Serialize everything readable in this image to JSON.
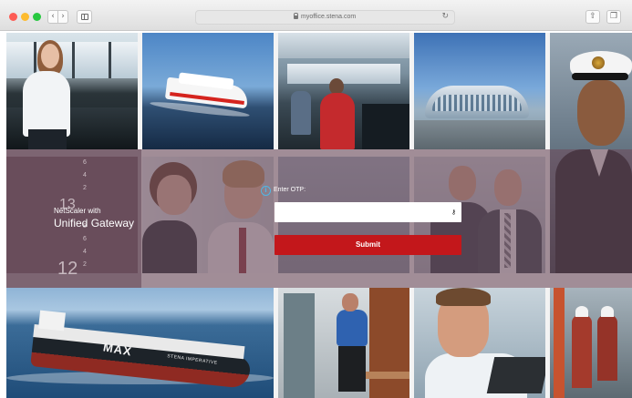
{
  "browser": {
    "url": "myoffice.stena.com",
    "back_icon": "chevron-left-icon",
    "forward_icon": "chevron-right-icon",
    "sidebar_icon": "sidebar-icon",
    "reload_icon": "reload-icon",
    "share_icon": "share-icon",
    "tabs_icon": "tabs-icon",
    "traffic_lights": [
      "#fd5c55",
      "#fdbb2f",
      "#28c840"
    ]
  },
  "background_tiles": [
    "bridge-officer-photo",
    "stena-line-ferry-photo",
    "ship-bridge-crew-photo",
    "cruise-terminal-photo",
    "naval-officer-photo",
    "office-colleagues-photo",
    "business-people-photo",
    "stena-tanker-photo",
    "deck-worker-photo",
    "engineer-laptop-photo",
    "port-workers-photo"
  ],
  "tanker": {
    "hull_label": "MAX",
    "name_label": "STENA IMPERATIVE"
  },
  "decor_digits": {
    "column": [
      "6",
      "4",
      "2",
      "",
      "",
      "8",
      "6",
      "4",
      "2"
    ],
    "large_top": "13",
    "large_bottom": "12"
  },
  "brand": {
    "subtitle": "NetScaler with",
    "title": "Unified Gateway"
  },
  "otp_form": {
    "info_icon": "info-icon",
    "label": "Enter OTP:",
    "input_value": "",
    "key_icon": "key-icon",
    "submit_label": "Submit",
    "accent_color": "#c3171b",
    "info_color": "#4fb7e4"
  }
}
